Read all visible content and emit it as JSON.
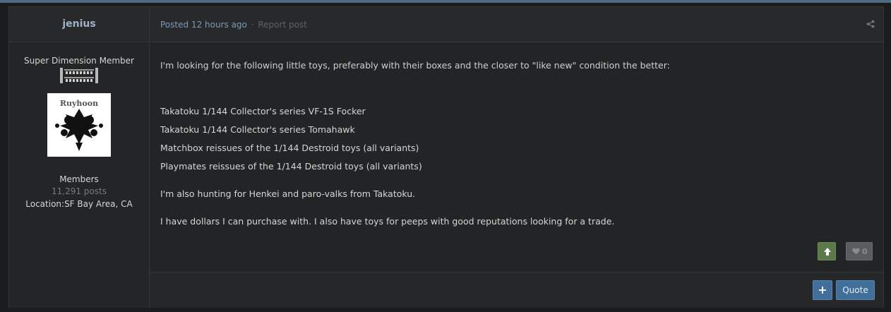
{
  "author": {
    "name": "jenius",
    "rank_title": "Super Dimension Member",
    "group": "Members",
    "post_count": "11,291 posts",
    "location_label": "Location:",
    "location_value": "SF Bay Area, CA",
    "avatar_text": "Ruyhoon"
  },
  "header": {
    "posted_prefix": "Posted",
    "posted_time": "12 hours ago",
    "separator": "·",
    "report_label": "Report post",
    "share_icon": "share-icon"
  },
  "post": {
    "intro": "I'm looking for the following little toys, preferably with their boxes and the closer to \"like new\" condition the better:",
    "items": [
      "Takatoku 1/144 Collector's series VF-1S Focker",
      "Takatoku 1/144 Collector's series Tomahawk",
      "Matchbox reissues of the 1/144 Destroid toys (all variants)",
      "Playmates reissues of the 1/144 Destroid toys (all variants)"
    ],
    "also_hunting": "I'm also hunting for Henkei and paro-valks from Takatoku.",
    "closing": "I have dollars I can purchase with. I also have toys for peeps with good reputations looking for a trade."
  },
  "reputation": {
    "count": "0",
    "upvote_icon": "arrow-up-icon",
    "heart_icon": "heart-icon"
  },
  "footer": {
    "multiquote_label": "+",
    "quote_label": "Quote"
  },
  "colors": {
    "page_bg": "#1b1c1d",
    "panel_bg": "#232425",
    "accent_blue": "#3f6f9a",
    "link_blue": "#7d9bb8",
    "upvote_green": "#5a7a4a"
  }
}
